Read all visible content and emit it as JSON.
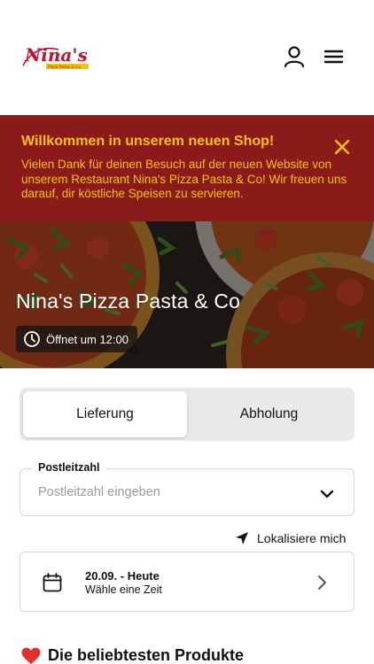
{
  "header": {
    "logo_text": "Nina's",
    "logo_subtext": "Pizza Pasta & Co",
    "icons": {
      "user": "user-icon",
      "menu": "menu-icon"
    }
  },
  "banner": {
    "title": "Willkommen in unserem neuen Shop!",
    "text": "Vielen Dank für deinen Besuch auf der neuen Website von unserem Restaurant Nina's Pizza Pasta & Co! Wir freuen uns darauf, dir köstliche Speisen zu servieren.",
    "close_icon": "close-icon",
    "colors": {
      "background": "#8b1a1a",
      "text": "#f5c400"
    }
  },
  "hero": {
    "title": "Nina's Pizza Pasta & Co",
    "opening": "Öffnet um 12:00",
    "icon": "clock-icon"
  },
  "order_tabs": {
    "items": [
      {
        "label": "Lieferung",
        "active": true
      },
      {
        "label": "Abholung",
        "active": false
      }
    ]
  },
  "postcode": {
    "label": "Postleitzahl",
    "placeholder": "Postleitzahl eingeben",
    "value": "",
    "icon": "chevron-down-icon"
  },
  "locate": {
    "label": "Lokalisiere mich",
    "icon": "location-arrow-icon"
  },
  "date_picker": {
    "date": "20.09. - Heute",
    "hint": "Wähle eine Zeit",
    "icons": {
      "calendar": "calendar-icon",
      "chevron": "chevron-right-icon"
    }
  },
  "popular": {
    "title": "Die beliebtesten Produkte",
    "icon": "heart-icon"
  }
}
